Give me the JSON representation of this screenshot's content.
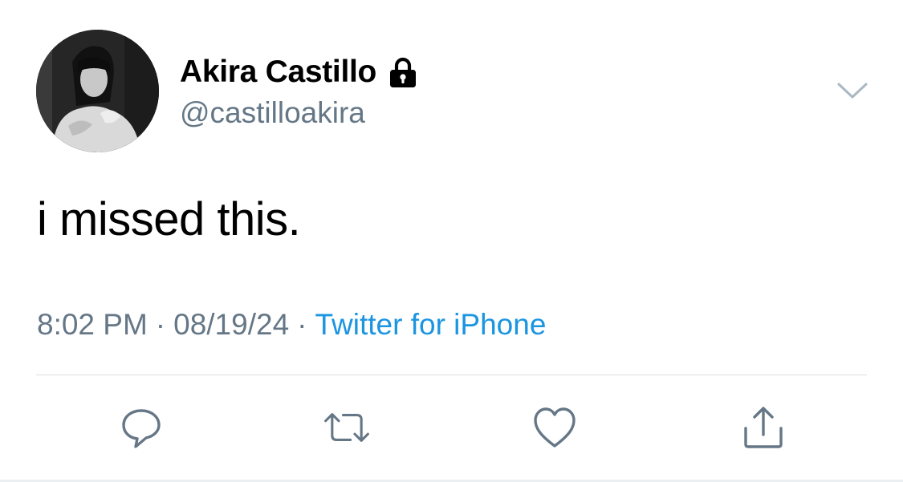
{
  "tweet": {
    "author": {
      "display_name": "Akira Castillo",
      "handle": "@castilloakira",
      "protected_icon": "lock-icon"
    },
    "text": "i missed this.",
    "time": "8:02 PM",
    "separator": "·",
    "date": "08/19/24",
    "source": "Twitter for iPhone"
  },
  "actions": [
    {
      "name": "reply",
      "icon": "reply-icon"
    },
    {
      "name": "retweet",
      "icon": "retweet-icon"
    },
    {
      "name": "like",
      "icon": "heart-icon"
    },
    {
      "name": "share",
      "icon": "share-icon"
    }
  ],
  "colors": {
    "text_primary": "#000000",
    "text_secondary": "#657786",
    "link": "#1b95e0",
    "divider": "#d9dde0",
    "background": "#ffffff"
  }
}
